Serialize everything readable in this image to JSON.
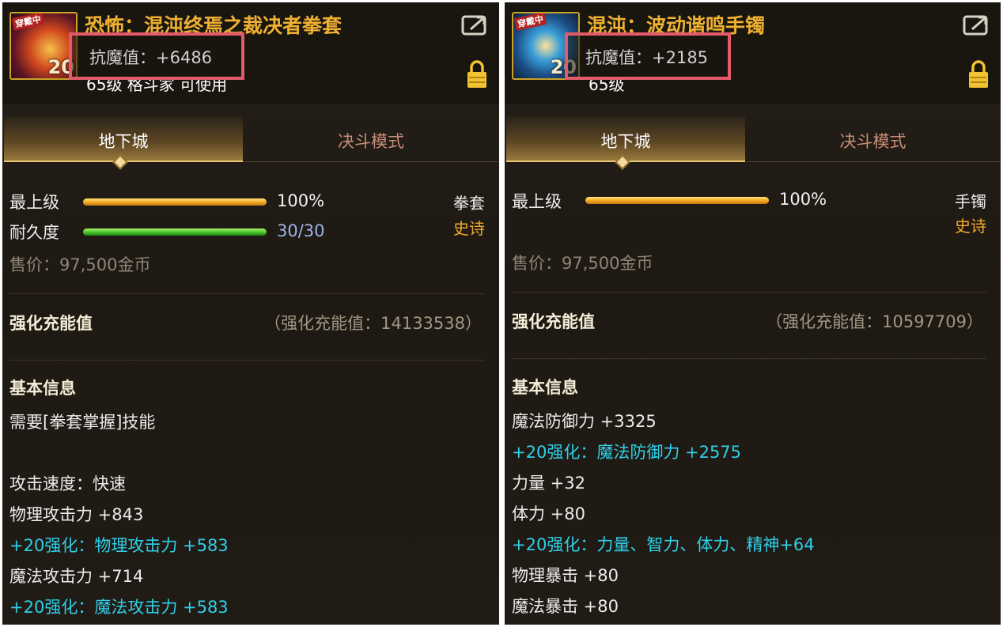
{
  "panels": [
    {
      "icon_tag": "穿戴中",
      "icon_level": "20",
      "item_name": "恐怖：混沌终焉之裁决者拳套",
      "anti_magic": "抗魔值：+6486",
      "level_requirement": "65级 格斗家 可使用",
      "tabs": {
        "active": "地下城",
        "inactive": "决斗模式"
      },
      "top_stat": {
        "label": "最上级",
        "percent": 100,
        "value": "100%"
      },
      "durability": {
        "label": "耐久度",
        "current": 30,
        "max": 30,
        "value": "30/30"
      },
      "item_type": "拳套",
      "rarity": "史诗",
      "sell_price": "售价：97,500金币",
      "charge": {
        "label": "强化充能值",
        "value": "（强化充能值：14133538）"
      },
      "basic_info_title": "基本信息",
      "lines": [
        {
          "text": "需要[拳套掌握]技能",
          "color": "white"
        },
        {
          "text": "",
          "color": "white"
        },
        {
          "text": "攻击速度：快速",
          "color": "white"
        },
        {
          "text": "物理攻击力 +843",
          "color": "white"
        },
        {
          "text": "+20强化：物理攻击力 +583",
          "color": "cyan"
        },
        {
          "text": "魔法攻击力 +714",
          "color": "white"
        },
        {
          "text": "+20强化：魔法攻击力 +583",
          "color": "cyan"
        }
      ]
    },
    {
      "icon_tag": "穿戴中",
      "icon_level": "20",
      "item_name": "混沌：波动谐鸣手镯",
      "anti_magic": "抗魔值：+2185",
      "level_requirement": "65级",
      "tabs": {
        "active": "地下城",
        "inactive": "决斗模式"
      },
      "top_stat": {
        "label": "最上级",
        "percent": 100,
        "value": "100%"
      },
      "item_type": "手镯",
      "rarity": "史诗",
      "sell_price": "售价：97,500金币",
      "charge": {
        "label": "强化充能值",
        "value": "（强化充能值：10597709）"
      },
      "basic_info_title": "基本信息",
      "lines": [
        {
          "text": "魔法防御力 +3325",
          "color": "white"
        },
        {
          "text": "+20强化：魔法防御力 +2575",
          "color": "cyan"
        },
        {
          "text": "力量 +32",
          "color": "white"
        },
        {
          "text": "体力 +80",
          "color": "white"
        },
        {
          "text": "+20强化：力量、智力、体力、精神+64",
          "color": "cyan"
        },
        {
          "text": "物理暴击 +80",
          "color": "white"
        },
        {
          "text": "魔法暴击 +80",
          "color": "white"
        }
      ]
    }
  ],
  "colors": {
    "item_name": "#efb131",
    "highlight_box": "#e35b6b",
    "enhance_text": "#2fd0e8",
    "rarity": "#f0a92c",
    "durability_value": "#9ab6e8"
  }
}
